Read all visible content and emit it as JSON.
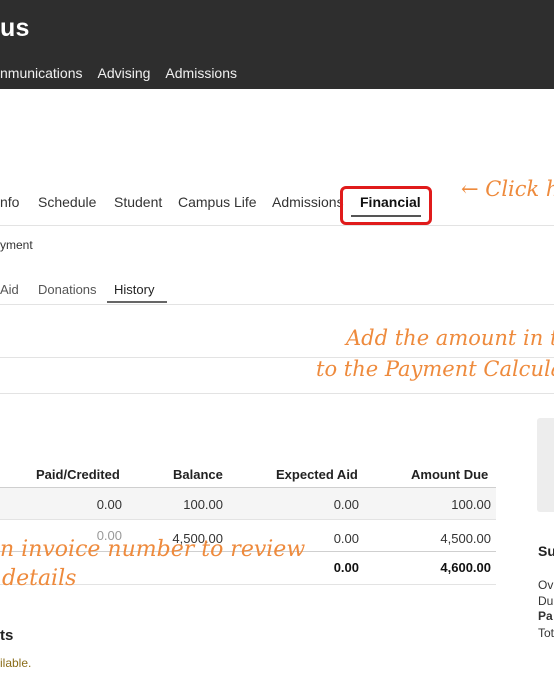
{
  "header": {
    "app_title": "us",
    "nav": [
      "nmunications",
      "Advising",
      "Admissions"
    ]
  },
  "tabs": [
    "nfo",
    "Schedule",
    "Student",
    "Campus Life",
    "Admissions",
    "Financial"
  ],
  "active_tab": "Financial",
  "subtitle": "yment",
  "subtabs": [
    "Aid",
    "Donations",
    "History"
  ],
  "active_subtab": "History",
  "annotations": {
    "click_here": "← Click h",
    "add_amount_1": "Add the amount in thi",
    "add_amount_2": "to the Payment Calcula",
    "invoice_1": "n invoice number to review",
    "invoice_2": "details"
  },
  "table": {
    "headers": [
      "Paid/Credited",
      "Balance",
      "Expected Aid",
      "Amount Due"
    ],
    "rows": [
      [
        "0.00",
        "100.00",
        "0.00",
        "100.00"
      ],
      [
        "0.00",
        "4,500.00",
        "0.00",
        "4,500.00"
      ]
    ],
    "total": [
      "0.00",
      "4,600.00"
    ]
  },
  "summary": {
    "title": "Su",
    "lines": [
      "Ov",
      "Du",
      "Pa",
      "Tot"
    ]
  },
  "section": {
    "title": "ts",
    "note": "ilable."
  },
  "colors": {
    "header_bg": "#2e2e2e",
    "highlight": "#e01b1b",
    "handwriting": "#ee8a3c"
  }
}
